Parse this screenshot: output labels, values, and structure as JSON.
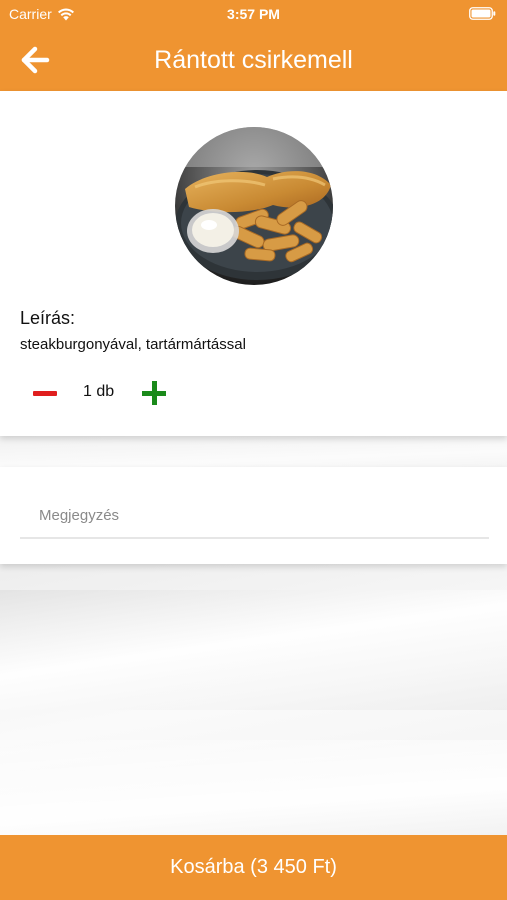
{
  "status_bar": {
    "carrier": "Carrier",
    "time": "3:57 PM"
  },
  "header": {
    "title": "Rántott csirkemell",
    "back_icon": "arrow-left-icon",
    "background_color": "#ef9431"
  },
  "product": {
    "image_icon": "food-photo",
    "description_label": "Leírás:",
    "description": "steakburgonyával, tartármártással",
    "quantity_text": "1 db",
    "minus_color": "#e01e1e",
    "plus_color": "#1a8a1a"
  },
  "note": {
    "placeholder": "Megjegyzés",
    "value": ""
  },
  "footer": {
    "cart_label": "Kosárba (3 450 Ft)"
  }
}
